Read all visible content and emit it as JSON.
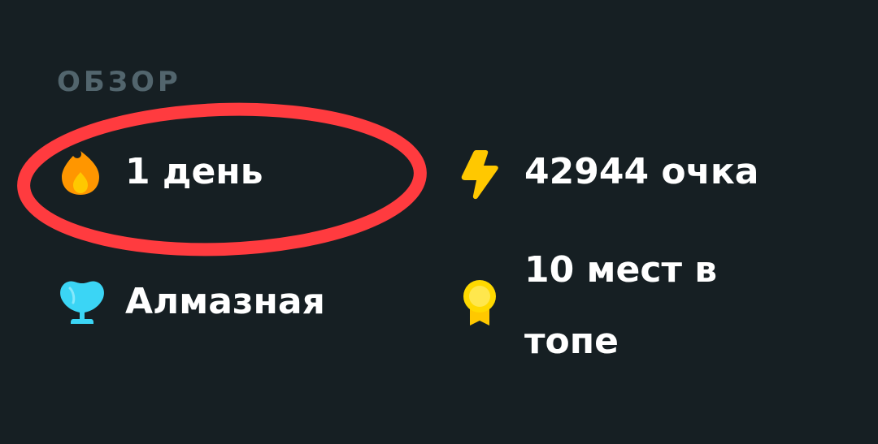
{
  "overview": {
    "section_title": "ОБЗОР",
    "stats": {
      "streak": {
        "label": "1 день",
        "icon": "fire-icon",
        "color": "#ff9600"
      },
      "xp": {
        "label": "42944 очка",
        "icon": "lightning-icon",
        "color": "#ffc800"
      },
      "league": {
        "label": "Алмазная",
        "icon": "diamond-league-trophy-icon",
        "color": "#3bd5f5"
      },
      "top": {
        "label": "10 мест в топе",
        "icon": "medal-icon",
        "color": "#ffd900"
      }
    },
    "annotation_color": "#ff3b3f"
  }
}
